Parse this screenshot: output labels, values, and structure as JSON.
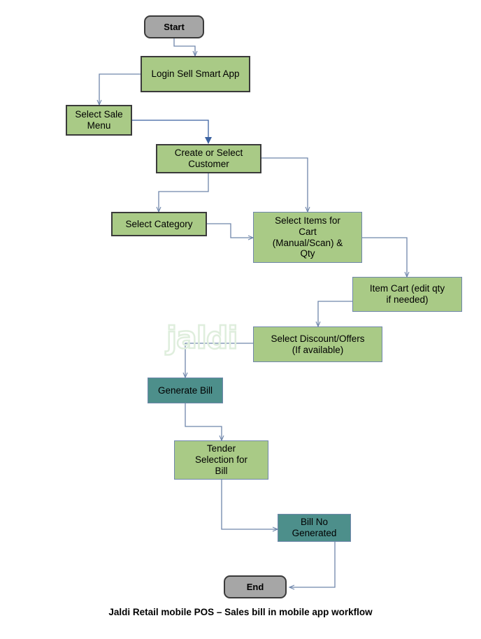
{
  "diagram": {
    "title": "Jaldi Retail mobile POS – Sales bill in mobile app workflow",
    "watermark": "jaldi",
    "colors": {
      "process_fill": "#a9ca86",
      "accent_fill": "#4d8f8b",
      "terminator_fill": "#a6a6a6",
      "edge_stroke": "#6f86ab",
      "dark_border": "#3a3a3a",
      "watermark": "#dfeedd"
    },
    "nodes": [
      {
        "id": "start",
        "label": "Start",
        "type": "terminator"
      },
      {
        "id": "login",
        "label": "Login Sell Smart App",
        "type": "process-dark"
      },
      {
        "id": "sale_menu",
        "label": "Select Sale\nMenu",
        "type": "process-dark"
      },
      {
        "id": "customer",
        "label": "Create or Select\nCustomer",
        "type": "process-dark"
      },
      {
        "id": "category",
        "label": "Select Category",
        "type": "process-dark"
      },
      {
        "id": "items",
        "label": "Select Items for\nCart\n(Manual/Scan) &\nQty",
        "type": "process"
      },
      {
        "id": "item_cart",
        "label": "Item Cart (edit qty\nif needed)",
        "type": "process"
      },
      {
        "id": "discount",
        "label": "Select Discount/Offers\n(If available)",
        "type": "process"
      },
      {
        "id": "generate",
        "label": "Generate Bill",
        "type": "accent"
      },
      {
        "id": "tender",
        "label": "Tender\nSelection for\nBill",
        "type": "process"
      },
      {
        "id": "bill_no",
        "label": "Bill No\nGenerated",
        "type": "accent"
      },
      {
        "id": "end",
        "label": "End",
        "type": "terminator"
      }
    ],
    "edges": [
      {
        "from": "start",
        "to": "login"
      },
      {
        "from": "login",
        "to": "sale_menu"
      },
      {
        "from": "sale_menu",
        "to": "customer"
      },
      {
        "from": "customer",
        "to": "category"
      },
      {
        "from": "customer",
        "to": "items"
      },
      {
        "from": "category",
        "to": "items"
      },
      {
        "from": "items",
        "to": "item_cart"
      },
      {
        "from": "item_cart",
        "to": "discount"
      },
      {
        "from": "discount",
        "to": "generate"
      },
      {
        "from": "generate",
        "to": "tender"
      },
      {
        "from": "tender",
        "to": "bill_no"
      },
      {
        "from": "bill_no",
        "to": "end"
      }
    ]
  }
}
